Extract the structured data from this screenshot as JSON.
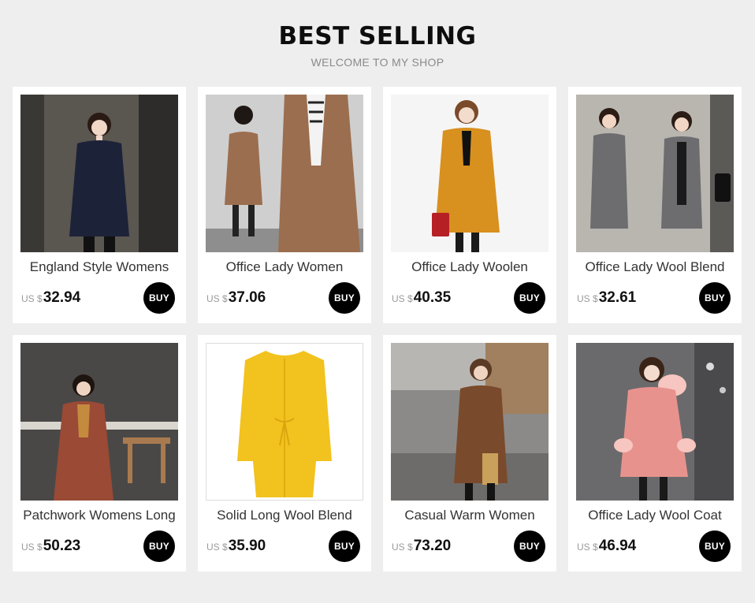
{
  "header": {
    "title": "BEST SELLING",
    "subtitle": "WELCOME TO MY SHOP"
  },
  "products": [
    {
      "name": "England Style Womens",
      "currency": "US $",
      "price": "32.94",
      "buy_label": "BUY",
      "coat_color": "#1c2238",
      "bg_color": "#5a5650"
    },
    {
      "name": "Office Lady Women",
      "currency": "US $",
      "price": "37.06",
      "buy_label": "BUY",
      "coat_color": "#9b6e4f",
      "bg_color": "#cfcfcf"
    },
    {
      "name": "Office Lady Woolen",
      "currency": "US $",
      "price": "40.35",
      "buy_label": "BUY",
      "coat_color": "#d8901f",
      "bg_color": "#f5f5f5"
    },
    {
      "name": "Office Lady Wool Blend",
      "currency": "US $",
      "price": "32.61",
      "buy_label": "BUY",
      "coat_color": "#6d6d70",
      "bg_color": "#b9b6b0"
    },
    {
      "name": "Patchwork Womens Long",
      "currency": "US $",
      "price": "50.23",
      "buy_label": "BUY",
      "coat_color": "#9a4a35",
      "bg_color": "#4a4846"
    },
    {
      "name": "Solid Long Wool Blend",
      "currency": "US $",
      "price": "35.90",
      "buy_label": "BUY",
      "coat_color": "#f2c21e",
      "bg_color": "#ffffff"
    },
    {
      "name": "Casual Warm Women",
      "currency": "US $",
      "price": "73.20",
      "buy_label": "BUY",
      "coat_color": "#7a4a2c",
      "bg_color": "#8c8a88"
    },
    {
      "name": "Office Lady Wool Coat",
      "currency": "US $",
      "price": "46.94",
      "buy_label": "BUY",
      "coat_color": "#e8928e",
      "bg_color": "#6a6a6c"
    }
  ]
}
